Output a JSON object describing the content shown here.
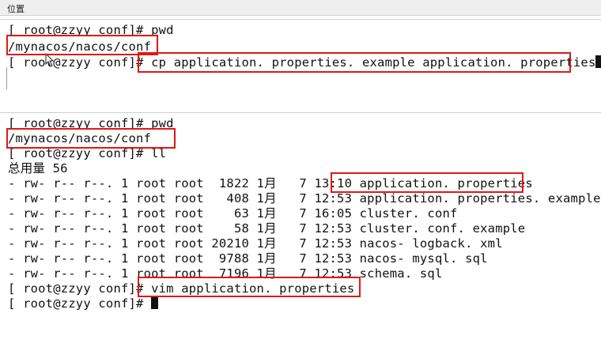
{
  "tab": {
    "label": "位置"
  },
  "terminal1": {
    "lines": [
      "[ root@zzyy conf]# pwd",
      "/mynacos/nacos/conf",
      "[ root@zzyy conf]# cp application. properties. example application. properties"
    ]
  },
  "terminal2": {
    "lines": [
      "[ root@zzyy conf]# pwd",
      "/mynacos/nacos/conf",
      "[ root@zzyy conf]# ll",
      "总用量 56",
      "- rw- r-- r--. 1 root root  1822 1月   7 13:10 application. properties",
      "- rw- r-- r--. 1 root root   408 1月   7 12:53 application. properties. example",
      "- rw- r-- r--. 1 root root    63 1月   7 16:05 cluster. conf",
      "- rw- r-- r--. 1 root root    58 1月   7 12:53 cluster. conf. example",
      "- rw- r-- r--. 1 root root 20210 1月   7 12:53 nacos- logback. xml",
      "- rw- r-- r--. 1 root root  9788 1月   7 12:53 nacos- mysql. sql",
      "- rw- r-- r--. 1 root root  7196 1月   7 12:53 schema. sql",
      "[ root@zzyy conf]# vim application. properties",
      "[ root@zzyy conf]# "
    ]
  },
  "colors": {
    "highlight": "#e01818"
  }
}
